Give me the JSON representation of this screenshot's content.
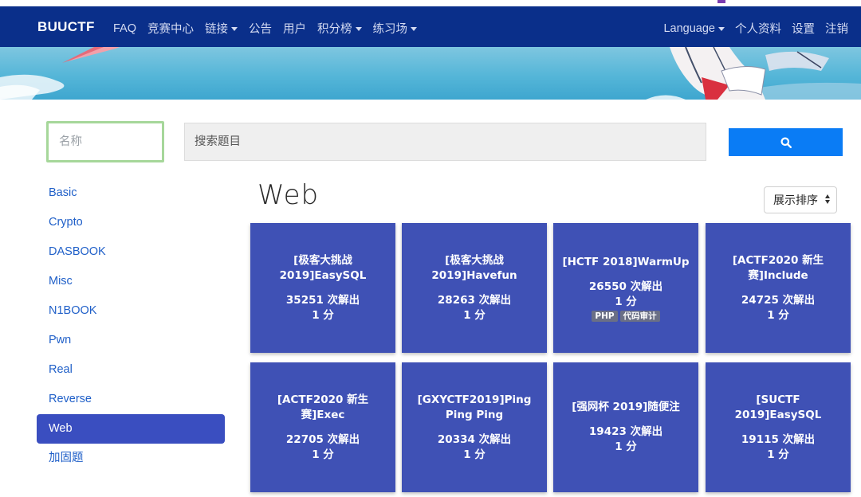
{
  "navbar": {
    "brand": "BUUCTF",
    "left_items": [
      {
        "label": "FAQ",
        "dropdown": false
      },
      {
        "label": "竞赛中心",
        "dropdown": false
      },
      {
        "label": "链接",
        "dropdown": true
      },
      {
        "label": "公告",
        "dropdown": false
      },
      {
        "label": "用户",
        "dropdown": false
      },
      {
        "label": "积分榜",
        "dropdown": true
      },
      {
        "label": "练习场",
        "dropdown": true
      }
    ],
    "right_items": [
      {
        "label": "Language",
        "dropdown": true
      },
      {
        "label": "个人资料",
        "dropdown": false
      },
      {
        "label": "设置",
        "dropdown": false
      },
      {
        "label": "注销",
        "dropdown": false
      }
    ]
  },
  "search": {
    "name_placeholder": "名称",
    "query_placeholder": "搜索题目",
    "button_icon": "search-icon"
  },
  "sidebar": {
    "items": [
      {
        "label": "Basic",
        "active": false
      },
      {
        "label": "Crypto",
        "active": false
      },
      {
        "label": "DASBOOK",
        "active": false
      },
      {
        "label": "Misc",
        "active": false
      },
      {
        "label": "N1BOOK",
        "active": false
      },
      {
        "label": "Pwn",
        "active": false
      },
      {
        "label": "Real",
        "active": false
      },
      {
        "label": "Reverse",
        "active": false
      },
      {
        "label": "Web",
        "active": true
      },
      {
        "label": "加固题",
        "active": false
      }
    ]
  },
  "main": {
    "title": "Web",
    "sort_label": "展示排序"
  },
  "challenges": [
    {
      "title": "[极客大挑战 2019]EasySQL",
      "solves": "35251 次解出",
      "points": "1 分",
      "tags": []
    },
    {
      "title": "[极客大挑战 2019]Havefun",
      "solves": "28263 次解出",
      "points": "1 分",
      "tags": []
    },
    {
      "title": "[HCTF 2018]WarmUp",
      "solves": "26550 次解出",
      "points": "1 分",
      "tags": [
        "PHP",
        "代码审计"
      ]
    },
    {
      "title": "[ACTF2020 新生赛]Include",
      "solves": "24725 次解出",
      "points": "1 分",
      "tags": []
    },
    {
      "title": "[ACTF2020 新生赛]Exec",
      "solves": "22705 次解出",
      "points": "1 分",
      "tags": []
    },
    {
      "title": "[GXYCTF2019]Ping Ping Ping",
      "solves": "20334 次解出",
      "points": "1 分",
      "tags": []
    },
    {
      "title": "[强网杯 2019]随便注",
      "solves": "19423 次解出",
      "points": "1 分",
      "tags": []
    },
    {
      "title": "[SUCTF 2019]EasySQL",
      "solves": "19115 次解出",
      "points": "1 分",
      "tags": []
    }
  ],
  "colors": {
    "navbar": "#0a2f8a",
    "card": "#3f51b5",
    "active_sidebar": "#3a4ec0",
    "search_button": "#0a7cf5",
    "link": "#1f5fc8"
  }
}
